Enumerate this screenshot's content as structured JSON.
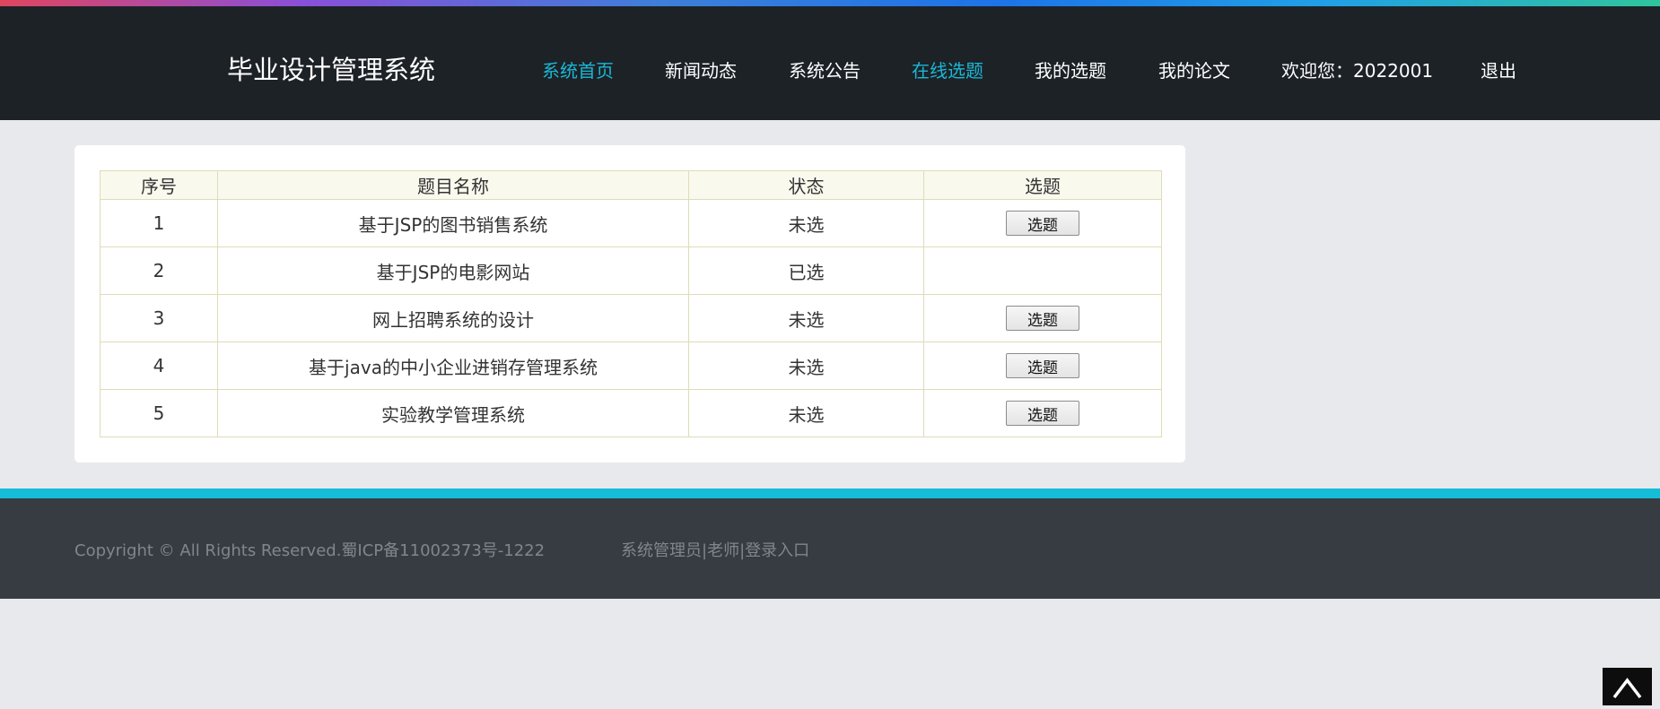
{
  "header": {
    "site_title": "毕业设计管理系统",
    "nav": [
      {
        "label": "系统首页",
        "active": true
      },
      {
        "label": "新闻动态",
        "active": false
      },
      {
        "label": "系统公告",
        "active": false
      },
      {
        "label": "在线选题",
        "active": true
      },
      {
        "label": "我的选题",
        "active": false
      },
      {
        "label": "我的论文",
        "active": false
      },
      {
        "label": "欢迎您：2022001",
        "active": false
      },
      {
        "label": "退出",
        "active": false
      }
    ]
  },
  "table": {
    "headers": [
      "序号",
      "题目名称",
      "状态",
      "选题"
    ],
    "rows": [
      {
        "no": "1",
        "title": "基于JSP的图书销售系统",
        "status": "未选",
        "action": "选题"
      },
      {
        "no": "2",
        "title": "基于JSP的电影网站",
        "status": "已选",
        "action": ""
      },
      {
        "no": "3",
        "title": "网上招聘系统的设计",
        "status": "未选",
        "action": "选题"
      },
      {
        "no": "4",
        "title": "基于java的中小企业进销存管理系统",
        "status": "未选",
        "action": "选题"
      },
      {
        "no": "5",
        "title": "实验教学管理系统",
        "status": "未选",
        "action": "选题"
      }
    ]
  },
  "footer": {
    "copyright": "Copyright © All Rights Reserved.蜀ICP备11002373号-1222",
    "links": [
      "系统管理员",
      "老师",
      "登录入口"
    ],
    "separator": "|"
  },
  "back_to_top_icon": "chevron-up-icon",
  "colors": {
    "header_bg": "#1d2227",
    "accent": "#1ab8d6",
    "footer_bg": "#363c41",
    "page_bg": "#e8e9ec"
  }
}
